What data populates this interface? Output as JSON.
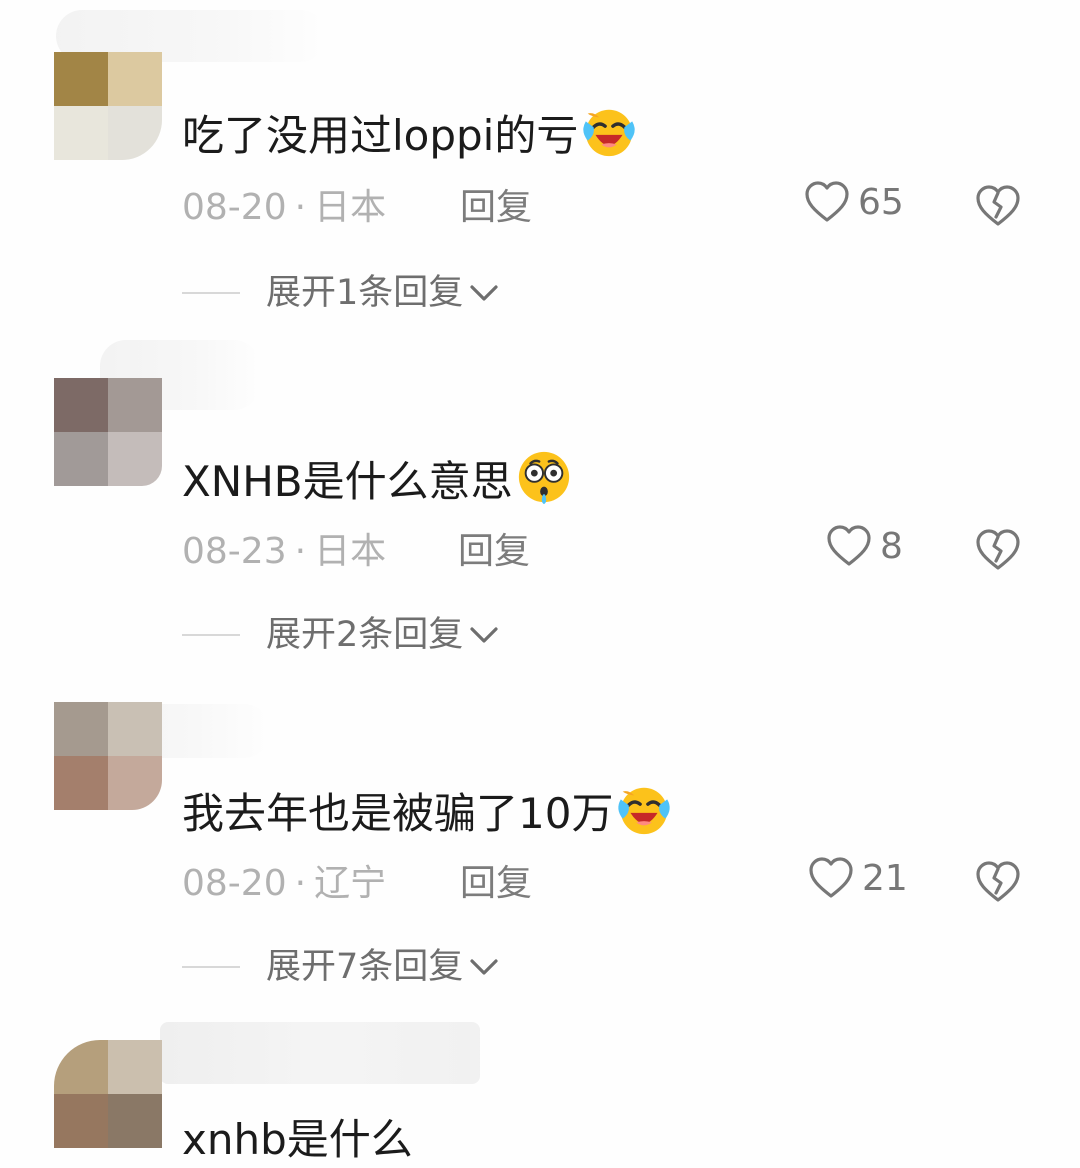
{
  "comments": [
    {
      "text": "吃了没用过loppi的亏",
      "emoji": "crying-laughing-face",
      "date": "08-20",
      "location": "日本",
      "reply_label": "回复",
      "likes": "65",
      "expand_label": "展开1条回复"
    },
    {
      "text": "XNHB是什么意思",
      "emoji": "flushed-face",
      "date": "08-23",
      "location": "日本",
      "reply_label": "回复",
      "likes": "8",
      "expand_label": "展开2条回复"
    },
    {
      "text": "我去年也是被骗了10万",
      "emoji": "crying-laughing-face",
      "date": "08-20",
      "location": "辽宁",
      "reply_label": "回复",
      "likes": "21",
      "expand_label": "展开7条回复"
    },
    {
      "text": "xnhb是什么"
    }
  ],
  "separator": "·",
  "colors": {
    "text": "#1b1b1b",
    "meta": "#b1b1b1",
    "reply": "#7c7c7c",
    "icon": "#777777"
  }
}
